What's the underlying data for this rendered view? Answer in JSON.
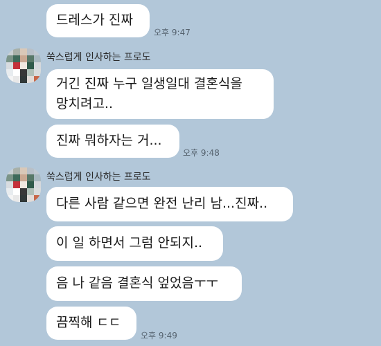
{
  "messages": [
    {
      "sender": "",
      "text": "드레스가 진짜",
      "time": "오후 9:47"
    },
    {
      "sender": "쑥스럽게 인사하는 프로도",
      "text_line1": "거긴 진짜 누구 일생일대 결혼식을",
      "text_line2": "망치려고..",
      "time": ""
    },
    {
      "sender": "",
      "text": "진짜 뭐하자는 거...",
      "time": "오후 9:48"
    },
    {
      "sender": "쑥스럽게 인사하는 프로도",
      "text": "다른 사람 같으면 완전 난리 남...진짜..",
      "time": ""
    },
    {
      "sender": "",
      "text": "이 일 하면서 그럼 안되지..",
      "time": ""
    },
    {
      "sender": "",
      "text": "음 나 같음 결혼식 엎었음ㅜㅜ",
      "time": ""
    },
    {
      "sender": "",
      "text": "끔찍해 ㄷㄷ",
      "time": "오후 9:49"
    }
  ],
  "avatar_colors": [
    "#c8d0d4",
    "#a8b0a8",
    "#d9c8b8",
    "#b8c0c8",
    "#c0c8d0",
    "#7a9488",
    "#3e6a5a",
    "#c9a892",
    "#587868",
    "#a8b8c0",
    "#d8dce0",
    "#c4303a",
    "#f0e8e0",
    "#2f5a4a",
    "#d4d8dc",
    "#e8ecef",
    "#ffffff",
    "#383838",
    "#b0c0b8",
    "#d8dcdc",
    "#f4f4f4",
    "#e8e8e8",
    "#303838",
    "#e2dcd8",
    "#c86848"
  ]
}
